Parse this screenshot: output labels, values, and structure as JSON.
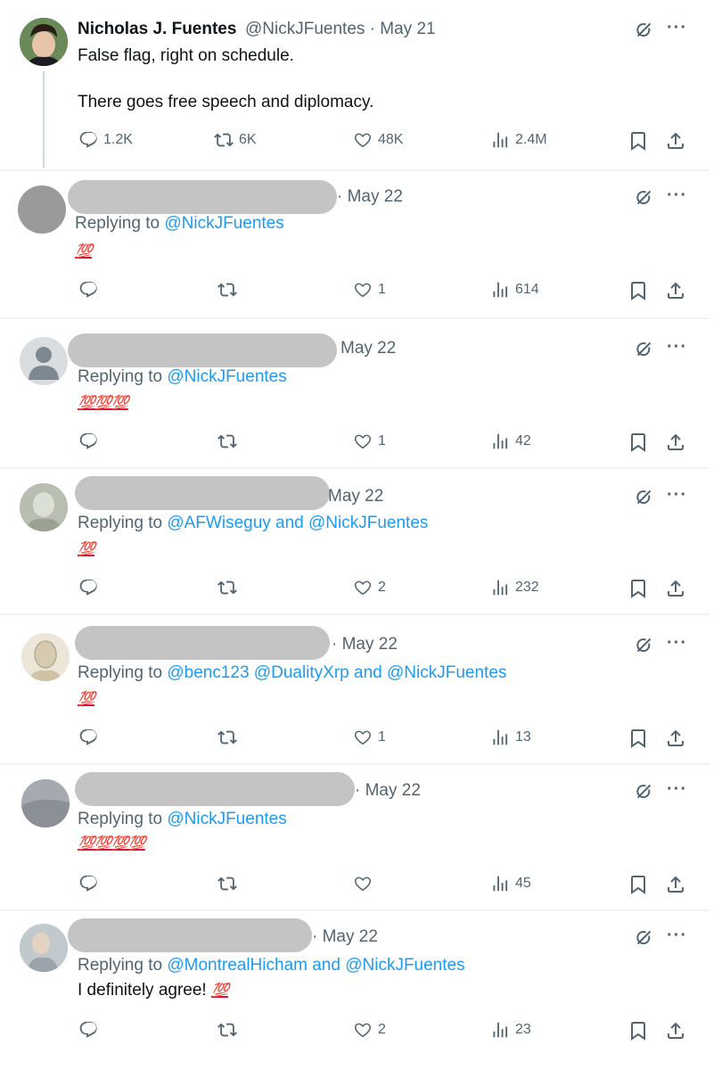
{
  "main_tweet": {
    "name": "Nicholas J. Fuentes",
    "handle": "@NickJFuentes · May 21",
    "line1": "False flag, right on schedule.",
    "line2": "There goes free speech and diplomacy.",
    "replies": "1.2K",
    "retweets": "6K",
    "likes": "48K",
    "views": "2.4M"
  },
  "replies": [
    {
      "date": "· May 22",
      "replying_prefix": "Replying to ",
      "mentions": "@NickJFuentes",
      "text": "",
      "emoji": "💯",
      "likes": "1",
      "views": "614"
    },
    {
      "date": "May 22",
      "replying_prefix": "Replying to ",
      "mentions": "@NickJFuentes",
      "text": "",
      "emoji": "💯💯💯",
      "likes": "1",
      "views": "42"
    },
    {
      "date": "May 22",
      "replying_prefix": "Replying to ",
      "mentions": "@AFWiseguy and @NickJFuentes",
      "text": "",
      "emoji": "💯",
      "likes": "2",
      "views": "232"
    },
    {
      "date": "· May 22",
      "replying_prefix": "Replying to ",
      "mentions": "@benc123 @DualityXrp and @NickJFuentes",
      "text": "",
      "emoji": "💯",
      "likes": "1",
      "views": "13"
    },
    {
      "date": "· May 22",
      "replying_prefix": "Replying to ",
      "mentions": "@NickJFuentes",
      "text": "",
      "emoji": "💯💯💯💯",
      "likes": "",
      "views": "45"
    },
    {
      "date": "· May 22",
      "replying_prefix": "Replying to ",
      "mentions": "@MontrealHicham and @NickJFuentes",
      "text": "I definitely agree!",
      "emoji": "💯",
      "likes": "2",
      "views": "23"
    }
  ],
  "icons": {
    "grok": "grok-icon",
    "more": "more-icon",
    "reply": "reply-icon",
    "retweet": "retweet-icon",
    "like": "heart-icon",
    "views": "views-icon",
    "bookmark": "bookmark-icon",
    "share": "share-icon"
  },
  "colors": {
    "mention": "#1d9bf0",
    "muted": "#536471",
    "redaction": "#c4c4c4",
    "emoji": "#d4143c"
  }
}
